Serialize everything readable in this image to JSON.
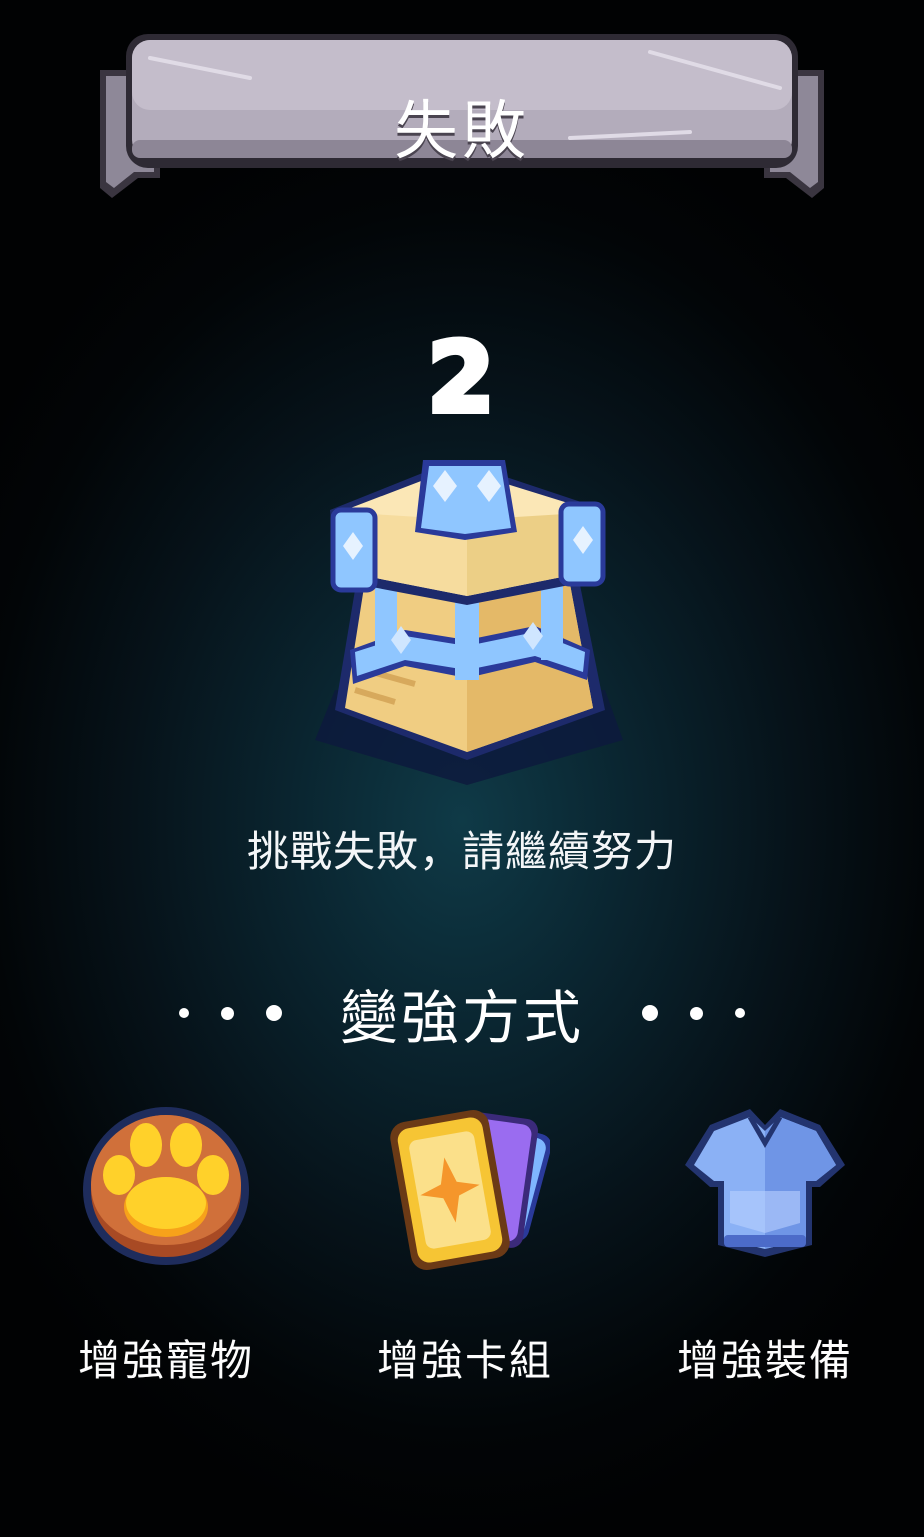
{
  "header": {
    "title": "失敗"
  },
  "result": {
    "level": "2",
    "message": "挑戰失敗，請繼續努力"
  },
  "improve": {
    "title": "變強方式",
    "options": [
      {
        "label": "增強寵物",
        "icon": "paw-icon"
      },
      {
        "label": "增強卡組",
        "icon": "cards-icon"
      },
      {
        "label": "增強裝備",
        "icon": "armor-icon"
      }
    ]
  },
  "colors": {
    "banner": "#9a93a3",
    "tower_gold": "#f2cf7e",
    "tower_blue": "#8fc6ff",
    "paw_orange": "#c8642f",
    "card_yellow": "#f6c534",
    "armor_blue": "#8bb1f5"
  }
}
